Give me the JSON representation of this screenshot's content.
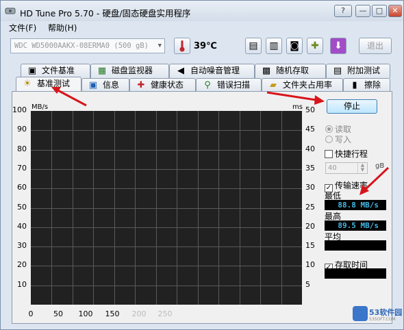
{
  "window": {
    "title": "HD Tune Pro 5.70 - 硬盘/固态硬盘实用程序",
    "buttons": {
      "help": "?",
      "minimize": "—",
      "maximize": "□",
      "close": "✕"
    }
  },
  "menu": [
    {
      "label": "文件(F)"
    },
    {
      "label": "帮助(H)"
    }
  ],
  "toolbar": {
    "drive": "WDC WD5000AAKX-08ERMA0 (500 gB)",
    "temperature": "39℃",
    "exit_label": "退出",
    "tool_icons": [
      "copy-text-icon",
      "copy-info-icon",
      "camera-icon",
      "health-icon",
      "download-icon"
    ]
  },
  "tabs_top": [
    {
      "label": "文件基准",
      "icon": "doc-icon"
    },
    {
      "label": "磁盘监视器",
      "icon": "monitor-icon"
    },
    {
      "label": "自动噪音管理",
      "icon": "speaker-icon"
    },
    {
      "label": "随机存取",
      "icon": "random-icon"
    },
    {
      "label": "附加测试",
      "icon": "extra-icon"
    }
  ],
  "tabs_bottom": [
    {
      "label": "基准测试",
      "icon": "bulb-icon",
      "active": true
    },
    {
      "label": "信息",
      "icon": "info-icon"
    },
    {
      "label": "健康状态",
      "icon": "health-icon"
    },
    {
      "label": "错误扫描",
      "icon": "scan-icon"
    },
    {
      "label": "文件夹占用率",
      "icon": "folder-icon"
    },
    {
      "label": "擦除",
      "icon": "trash-icon"
    }
  ],
  "chart_data": {
    "type": "line",
    "y_left_unit": "MB/s",
    "y_right_unit": "ms",
    "y_left_ticks": [
      100,
      90,
      80,
      70,
      60,
      50,
      40,
      30,
      20,
      10
    ],
    "y_right_ticks": [
      50,
      45,
      40,
      35,
      30,
      25,
      20,
      15,
      10,
      5
    ],
    "x_ticks": [
      "0",
      "50",
      "100",
      "150",
      "200",
      "250"
    ],
    "ylim": [
      0,
      100
    ],
    "grid": true,
    "series": []
  },
  "controls": {
    "stop_label": "停止",
    "read_label": "读取",
    "write_label": "写入",
    "quick_label": "快捷行程",
    "quick_value": "40",
    "quick_unit": "gB",
    "transfer_label": "传输速率",
    "min_label": "最低",
    "min_value": "88.8 MB/s",
    "max_label": "最高",
    "max_value": "89.5 MB/s",
    "avg_label": "平均",
    "avg_value": "",
    "access_label": "存取时间",
    "access_value": "",
    "check_mark": "✓"
  },
  "watermark": {
    "name": "53软件园",
    "sub": "53SOFT.COM"
  }
}
